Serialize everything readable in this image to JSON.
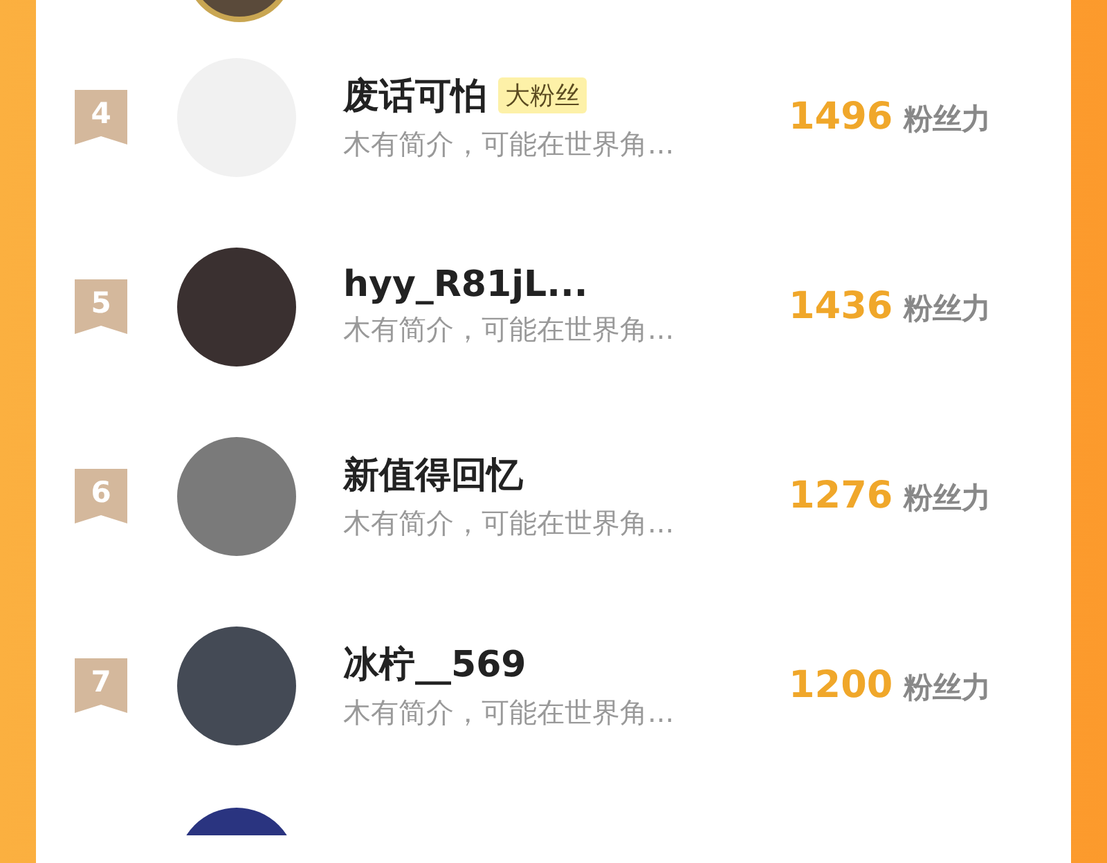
{
  "rows": [
    {
      "rank": "4",
      "name": "废话可怕",
      "badge": "大粉丝",
      "bio": "木有简介，可能在世界角...",
      "score": "1496",
      "unit": "粉丝力"
    },
    {
      "rank": "5",
      "name": "hyy_R81jL...",
      "bio": "木有简介，可能在世界角...",
      "score": "1436",
      "unit": "粉丝力"
    },
    {
      "rank": "6",
      "name": "新值得回忆",
      "bio": "木有简介，可能在世界角...",
      "score": "1276",
      "unit": "粉丝力"
    },
    {
      "rank": "7",
      "name": "冰柠__569",
      "bio": "木有简介，可能在世界角...",
      "score": "1200",
      "unit": "粉丝力"
    }
  ]
}
